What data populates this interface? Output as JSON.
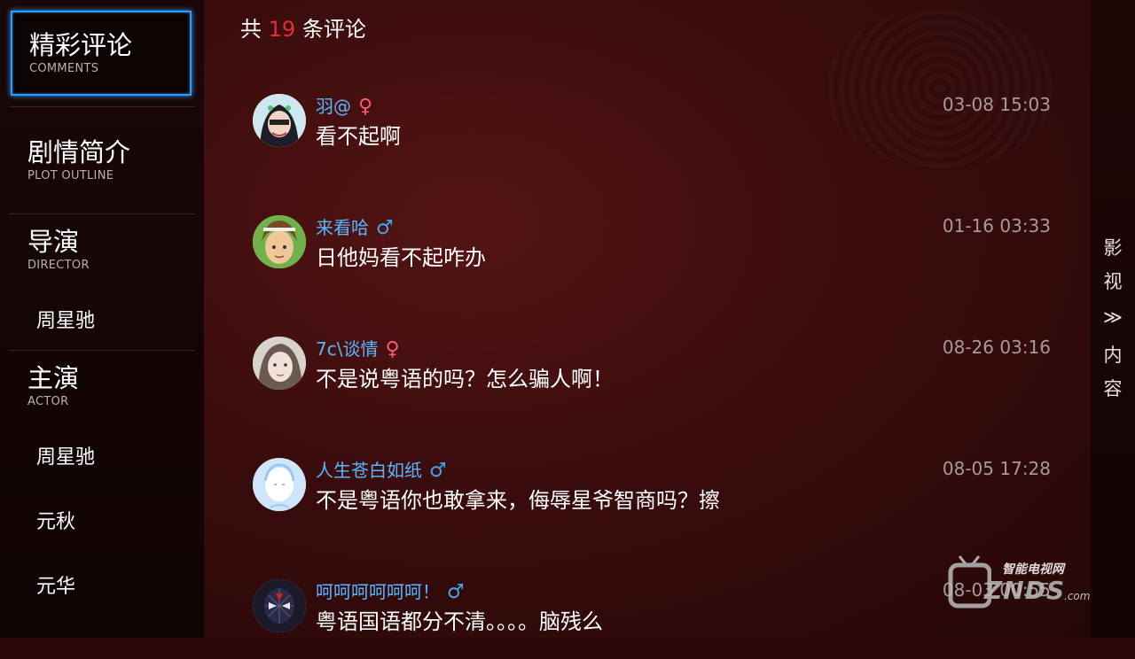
{
  "sidebar": {
    "comments": {
      "title": "精彩评论",
      "sub": "COMMENTS"
    },
    "plot": {
      "title": "剧情简介",
      "sub": "PLOT OUTLINE"
    },
    "director": {
      "title": "导演",
      "sub": "DIRECTOR",
      "people": [
        "周星驰"
      ]
    },
    "actor": {
      "title": "主演",
      "sub": "ACTOR",
      "people": [
        "周星驰",
        "元秋",
        "元华"
      ]
    }
  },
  "main": {
    "count_prefix": "共",
    "count": "19",
    "count_suffix": "条评论",
    "comments": [
      {
        "user": "羽@",
        "gender": "♀",
        "text": "看不起啊",
        "time": "03-08 15:03"
      },
      {
        "user": "来看哈",
        "gender": "♂",
        "text": "日他妈看不起咋办",
        "time": "01-16 03:33"
      },
      {
        "user": "7c\\谈情",
        "gender": "♀",
        "text": "不是说粤语的吗？怎么骗人啊！",
        "time": "08-26 03:16"
      },
      {
        "user": "人生苍白如纸",
        "gender": "♂",
        "text": "不是粤语你也敢拿来，侮辱星爷智商吗？擦",
        "time": "08-05 17:28"
      },
      {
        "user": "呵呵呵呵呵呵！",
        "gender": "♂",
        "text": "粤语国语都分不清。。。。脑残么",
        "time": "08-03 00:55"
      }
    ]
  },
  "right_strip": {
    "chars": [
      "影",
      "视",
      "≫",
      "内",
      "容"
    ]
  },
  "watermark": {
    "cn": "智能电视网",
    "en": "ZNDS",
    "domain": ".com"
  },
  "colors": {
    "accent_blue": "#2e9bff",
    "count_red": "#e53030",
    "username_blue": "#58b6ff",
    "female": "#ff5a6e",
    "male": "#3fa7e8"
  }
}
